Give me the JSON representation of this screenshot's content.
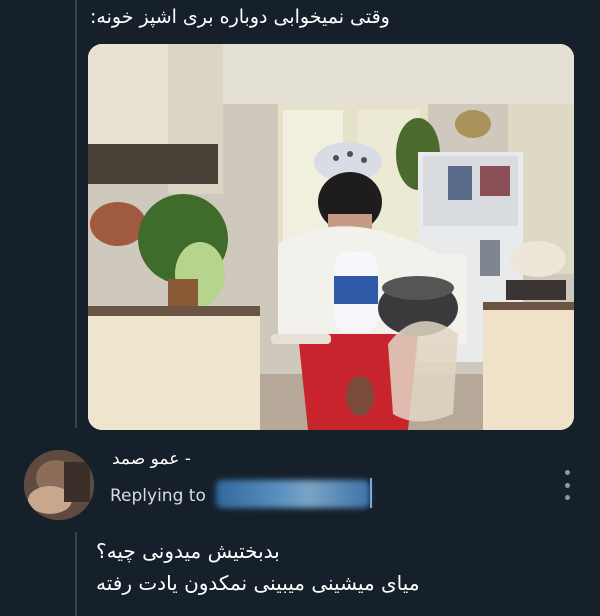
{
  "tweet": {
    "text": "وقتی نمیخوابی دوباره بری اشپز خونه:",
    "media_alt_icon": "video-still"
  },
  "reply": {
    "author_name": "- عمو صمد",
    "replying_to_label": "Replying to",
    "handle_blurred": "",
    "lines": [
      "بدبختیش میدونی چیه؟",
      "میای میشینی میبینی نمکدون یادت رفته"
    ],
    "more_icon": "more-vertical-icon"
  },
  "colors": {
    "background": "#15202b",
    "thread_line": "#38444d",
    "secondary_text": "#d9dde1",
    "link_blue": "#1d9bf0"
  }
}
